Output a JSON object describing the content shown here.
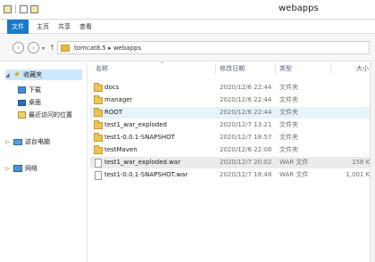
{
  "window": {
    "title": "webapps"
  },
  "ribbon": {
    "tabs": [
      "文件",
      "主页",
      "共享",
      "查看"
    ]
  },
  "address": {
    "path": "tomcat8.5 ▸ webapps"
  },
  "nav": {
    "favorites": "收藏夹",
    "items": [
      "下载",
      "桌面",
      "最近访问的位置"
    ],
    "computer": "这台电脑",
    "network": "网络"
  },
  "columns": {
    "name": "名称",
    "date": "修改日期",
    "type": "类型",
    "size": "大小"
  },
  "files": [
    {
      "name": "docs",
      "date": "2020/12/6 22:44",
      "type": "文件夹",
      "size": "",
      "icon": "folder-icon"
    },
    {
      "name": "manager",
      "date": "2020/12/6 22:44",
      "type": "文件夹",
      "size": "",
      "icon": "folder-icon"
    },
    {
      "name": "ROOT",
      "date": "2020/12/6 22:44",
      "type": "文件夹",
      "size": "",
      "icon": "folder-icon"
    },
    {
      "name": "test1_war_exploded",
      "date": "2020/12/7 13:21",
      "type": "文件夹",
      "size": "",
      "icon": "folder-icon"
    },
    {
      "name": "test1-0.0.1-SNAPSHOT",
      "date": "2020/12/7 18:57",
      "type": "文件夹",
      "size": "",
      "icon": "folder-icon"
    },
    {
      "name": "testMaven",
      "date": "2020/12/6 22:08",
      "type": "文件夹",
      "size": "",
      "icon": "folder-icon"
    },
    {
      "name": "test1_war_exploded.war",
      "date": "2020/12/7 20:02",
      "type": "WAR 文件",
      "size": "158 KB",
      "icon": "war-file-icon"
    },
    {
      "name": "test1-0.0.1-SNAPSHOT.war",
      "date": "2020/12/7 18:48",
      "type": "WAR 文件",
      "size": "1,001 KB",
      "icon": "war-file-icon"
    }
  ]
}
